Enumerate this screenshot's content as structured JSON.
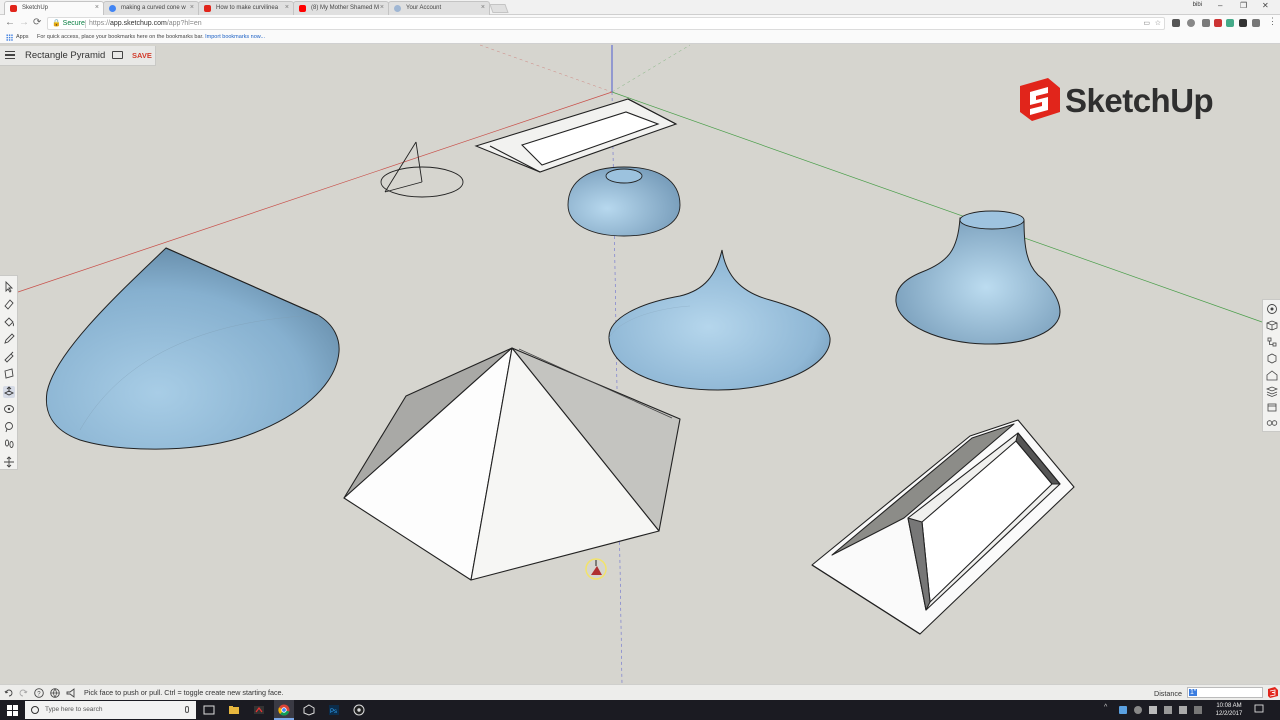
{
  "browser": {
    "tabs": [
      {
        "title": "SketchUp",
        "favicon_color": "#e1251b",
        "active": true
      },
      {
        "title": "making a curved cone w",
        "favicon_color": "#4285f4",
        "active": false
      },
      {
        "title": "How to make curvilinea",
        "favicon_color": "#e1251b",
        "active": false
      },
      {
        "title": "(8) My Mother Shamed M",
        "favicon_color": "#ff0000",
        "active": false
      },
      {
        "title": "Your Account",
        "favicon_color": "#9fb6d3",
        "active": false
      }
    ],
    "close_glyph": "×",
    "user_badge": "bibi",
    "window_controls": {
      "minimize": "–",
      "maximize": "❐",
      "close": "✕"
    },
    "nav": {
      "back": "←",
      "forward": "→",
      "reload": "⟳"
    },
    "url": {
      "secure_label": "Secure",
      "scheme": "https://",
      "host": "app.sketchup.com",
      "path": "/app?hl=en"
    },
    "bookmarks": {
      "apps_label": "Apps",
      "hint": "For quick access, place your bookmarks here on the bookmarks bar.",
      "import_link": "Import bookmarks now..."
    }
  },
  "app": {
    "model_title": "Rectangle Pyramid",
    "save_label": "SAVE",
    "logo_text": "SketchUp",
    "brand_color": "#e1251b"
  },
  "left_toolbar": {
    "tools": [
      "select-icon",
      "eraser-icon",
      "paint-bucket-icon",
      "pencil-icon",
      "tape-measure-icon",
      "rectangle-icon",
      "push-pull-icon",
      "orbit-icon",
      "lasso-icon",
      "footprint-icon",
      "pan-icon"
    ],
    "active_tool": "push-pull-icon"
  },
  "right_toolbar": {
    "tools": [
      "instructor-icon",
      "components-icon",
      "outliner-icon",
      "entity-info-icon",
      "3d-warehouse-icon",
      "layers-icon",
      "scenes-icon",
      "display-icon"
    ]
  },
  "status": {
    "hint": "Pick face to push or pull. Ctrl = toggle create new starting face.",
    "distance_label": "Distance",
    "distance_value": "1\""
  },
  "taskbar": {
    "search_placeholder": "Type here to search",
    "time": "10:08 AM",
    "date": "12/2/2017"
  }
}
